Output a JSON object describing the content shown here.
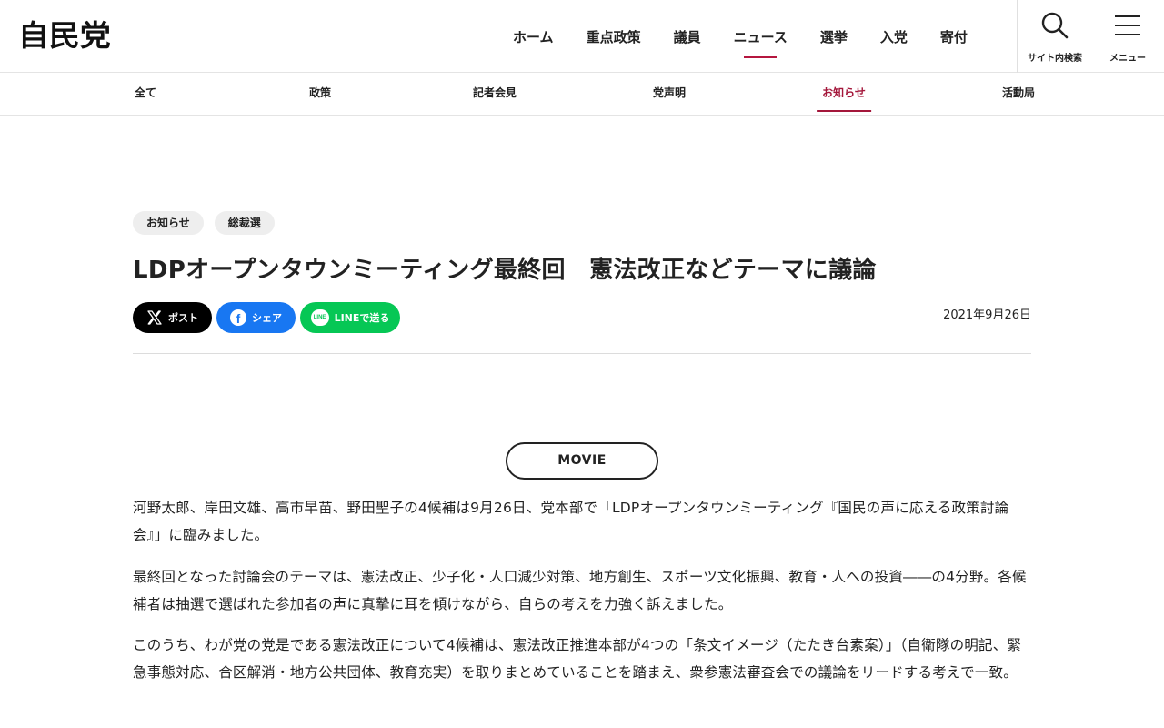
{
  "header": {
    "logo": "自民党",
    "nav": [
      {
        "label": "ホーム",
        "active": false
      },
      {
        "label": "重点政策",
        "active": false
      },
      {
        "label": "議員",
        "active": false
      },
      {
        "label": "ニュース",
        "active": true
      },
      {
        "label": "選挙",
        "active": false
      },
      {
        "label": "入党",
        "active": false
      },
      {
        "label": "寄付",
        "active": false
      }
    ],
    "search_label": "サイト内検索",
    "menu_label": "メニュー"
  },
  "subnav": [
    {
      "label": "全て",
      "active": false
    },
    {
      "label": "政策",
      "active": false
    },
    {
      "label": "記者会見",
      "active": false
    },
    {
      "label": "党声明",
      "active": false
    },
    {
      "label": "お知らせ",
      "active": true
    },
    {
      "label": "活動局",
      "active": false
    }
  ],
  "article": {
    "tags": [
      "お知らせ",
      "総裁選"
    ],
    "title": "LDPオープンタウンミーティング最終回　憲法改正などテーマに議論",
    "date": "2021年9月26日",
    "share": {
      "x_label": "ポスト",
      "fb_label": "シェア",
      "line_label": "LINEで送る",
      "line_icon_text": "LINE",
      "fb_icon_text": "f"
    },
    "movie_label": "MOVIE",
    "paragraphs": [
      "河野太郎、岸田文雄、高市早苗、野田聖子の4候補は9月26日、党本部で「LDPオープンタウンミーティング『国民の声に応える政策討論会』」に臨みました。",
      "最終回となった討論会のテーマは、憲法改正、少子化・人口減少対策、地方創生、スポーツ文化振興、教育・人への投資――の4分野。各候補者は抽選で選ばれた参加者の声に真摯に耳を傾けながら、自らの考えを力強く訴えました。",
      "このうち、わが党の党是である憲法改正について4候補は、憲法改正推進本部が4つの「条文イメージ（たたき台素案）」（自衛隊の明記、緊急事態対応、合区解消・地方公共団体、教育充実）を取りまとめていることを踏まえ、衆参憲法審査会での議論をリードする考えで一致。"
    ]
  },
  "colors": {
    "accent": "#a4173b",
    "x": "#000000",
    "facebook": "#1877f2",
    "line": "#06c755"
  }
}
